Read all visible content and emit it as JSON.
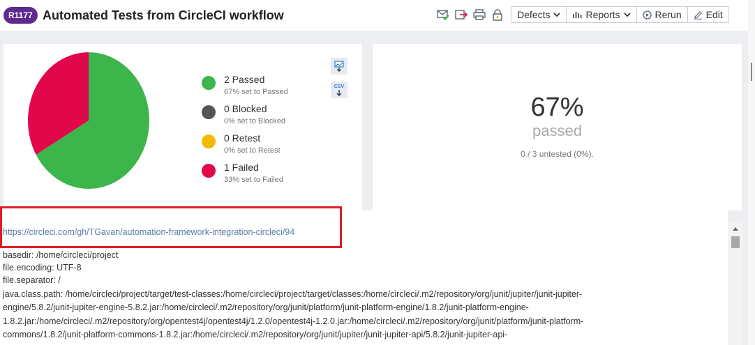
{
  "header": {
    "run_id": "R1177",
    "title": "Automated Tests from CircleCI workflow",
    "defects_label": "Defects",
    "reports_label": "Reports",
    "rerun_label": "Rerun",
    "edit_label": "Edit"
  },
  "summary": {
    "legend": [
      {
        "title": "2 Passed",
        "sub": "67% set to Passed",
        "color": "#3cb54a"
      },
      {
        "title": "0 Blocked",
        "sub": "0% set to Blocked",
        "color": "#555555"
      },
      {
        "title": "0 Retest",
        "sub": "0% set to Retest",
        "color": "#f2b900"
      },
      {
        "title": "1 Failed",
        "sub": "33% set to Failed",
        "color": "#e2074b"
      }
    ],
    "pie": [
      {
        "status": "Passed",
        "fraction": 0.6667,
        "color": "#3cb54a"
      },
      {
        "status": "Failed",
        "fraction": 0.3333,
        "color": "#e2074b"
      }
    ],
    "csv_label": "CSV",
    "percent": "67%",
    "percent_label": "passed",
    "untested": "0 / 3 untested (0%)."
  },
  "description": {
    "link": "https://circleci.com/gh/TGavan/automation-framework-integration-circleci/94",
    "lines": [
      "basedir: /home/circleci/project",
      "file.encoding: UTF-8",
      "file.separator: /",
      "java.class.path: /home/circleci/project/target/test-classes:/home/circleci/project/target/classes:/home/circleci/.m2/repository/org/junit/jupiter/junit-jupiter-",
      "engine/5.8.2/junit-jupiter-engine-5.8.2.jar:/home/circleci/.m2/repository/org/junit/platform/junit-platform-engine/1.8.2/junit-platform-engine-",
      "1.8.2.jar:/home/circleci/.m2/repository/org/opentest4j/opentest4j/1.2.0/opentest4j-1.2.0.jar:/home/circleci/.m2/repository/org/junit/platform/junit-platform-",
      "commons/1.8.2/junit-platform-commons-1.8.2.jar:/home/circleci/.m2/repository/org/junit/jupiter/junit-jupiter-api/5.8.2/junit-jupiter-api-"
    ]
  },
  "icons": {
    "h1": "email-check-icon",
    "h2": "export-icon",
    "h3": "print-icon",
    "h4": "lock-icon"
  }
}
